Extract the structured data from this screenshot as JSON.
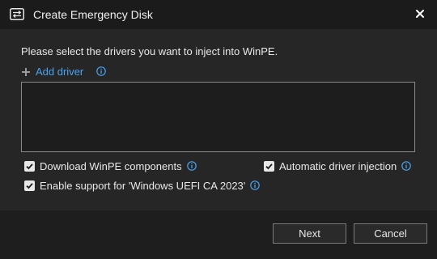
{
  "window": {
    "title": "Create Emergency Disk"
  },
  "instruction": "Please select the drivers you want to inject into WinPE.",
  "add_driver": {
    "label": "Add driver"
  },
  "driver_list": {
    "items": []
  },
  "options": {
    "download_winpe": {
      "label": "Download WinPE components",
      "checked": true
    },
    "auto_injection": {
      "label": "Automatic driver injection",
      "checked": true
    },
    "uefi_ca": {
      "label": "Enable support for 'Windows UEFI CA 2023'",
      "checked": true
    }
  },
  "buttons": {
    "next": "Next",
    "cancel": "Cancel"
  },
  "colors": {
    "accent": "#4aa3f0",
    "info": "#4aa3f0"
  }
}
